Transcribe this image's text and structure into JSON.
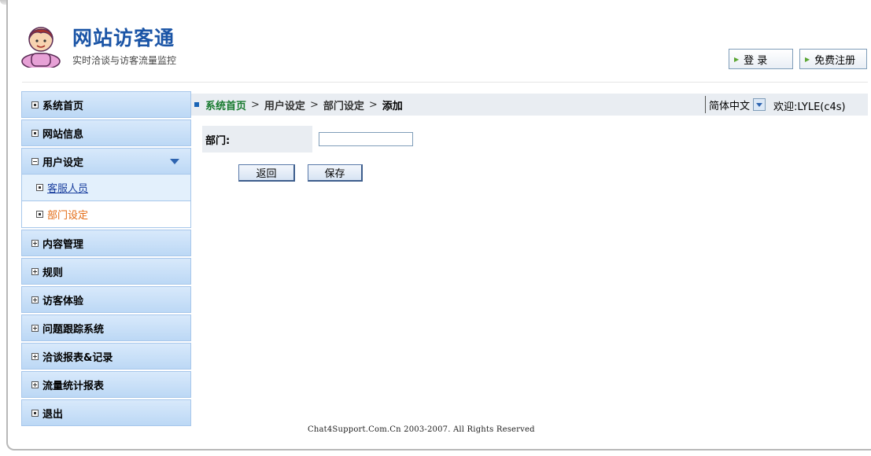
{
  "header": {
    "title": "网站访客通",
    "subtitle": "实时洽谈与访客流量监控",
    "login_label": "登 录",
    "register_label": "免费注册"
  },
  "sidebar": {
    "items": [
      {
        "label": "系统首页",
        "icon": "box-dot-icon"
      },
      {
        "label": "网站信息",
        "icon": "box-dot-icon"
      },
      {
        "label": "用户设定",
        "icon": "box-minus-icon",
        "expanded": true
      },
      {
        "label": "内容管理",
        "icon": "box-plus-icon"
      },
      {
        "label": "规则",
        "icon": "box-plus-icon"
      },
      {
        "label": "访客体验",
        "icon": "box-plus-icon"
      },
      {
        "label": "问题跟踪系统",
        "icon": "box-plus-icon"
      },
      {
        "label": "洽谈报表&记录",
        "icon": "box-plus-icon"
      },
      {
        "label": "流量统计报表",
        "icon": "box-plus-icon"
      },
      {
        "label": "退出",
        "icon": "box-dot-icon"
      }
    ],
    "subitems": [
      {
        "label": "客服人员",
        "active": false
      },
      {
        "label": "部门设定",
        "active": true
      }
    ]
  },
  "breadcrumb": {
    "home": "系统首页",
    "sep": ">",
    "user_settings": "用户设定",
    "dept_settings": "部门设定",
    "current": "添加"
  },
  "language": {
    "selected": "简体中文"
  },
  "welcome": "欢迎:LYLE(c4s)",
  "form": {
    "dept_label": "部门:",
    "dept_value": "",
    "back_label": "返回",
    "save_label": "保存"
  },
  "footer": "Chat4Support.Com.Cn 2003-2007. All Rights Reserved",
  "colors": {
    "brand": "#1a54a6",
    "sidebar_bg": "#c8e0f8",
    "active_link": "#e36a12",
    "breadcrumb_home": "#177a2e"
  }
}
